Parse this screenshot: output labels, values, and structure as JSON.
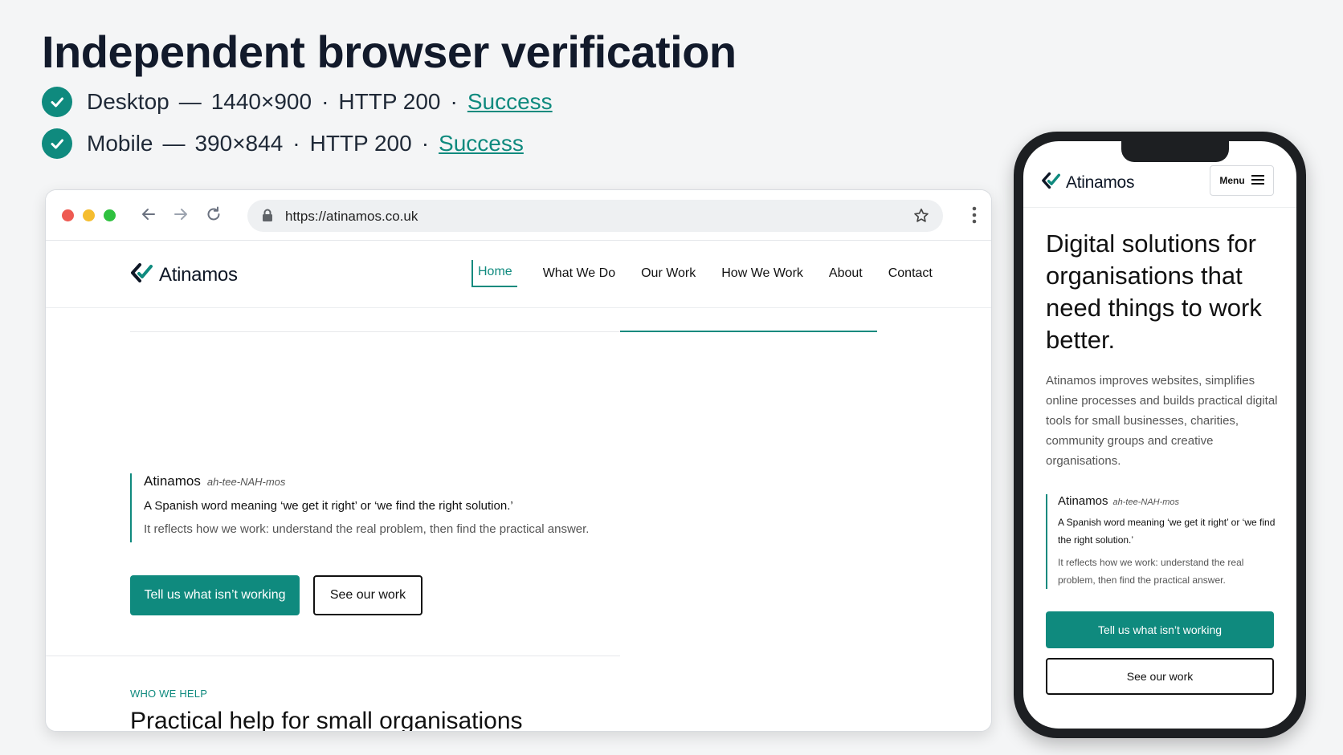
{
  "title": "Independent browser verification",
  "checks": [
    {
      "device": "Desktop",
      "dash": "—",
      "size": "1440×900",
      "dot1": "·",
      "http": "HTTP 200",
      "dot2": "·",
      "result": "Success"
    },
    {
      "device": "Mobile",
      "dash": "—",
      "size": "390×844",
      "dot1": "·",
      "http": "HTTP 200",
      "dot2": "·",
      "result": "Success"
    }
  ],
  "colors": {
    "accent": "#0f8a7e",
    "text": "#121a2b",
    "background": "#f4f5f6"
  },
  "browser": {
    "url": "https://atinamos.co.uk",
    "icons": [
      "close-light",
      "minimize-light",
      "zoom-light",
      "back-arrow-icon",
      "forward-arrow-icon",
      "reload-icon",
      "lock-icon",
      "bookmark-star-icon",
      "more-vert-icon"
    ]
  },
  "site": {
    "logo": "Atinamos",
    "nav": [
      "Home",
      "What We Do",
      "Our Work",
      "How We Work",
      "About",
      "Contact"
    ],
    "active_nav": "Home",
    "quote": {
      "name": "Atinamos",
      "pronunciation": "ah-tee-NAH-mos",
      "meaning": "A Spanish word meaning ‘we get it right’ or ‘we find the right solution.’",
      "note": "It reflects how we work: understand the real problem, then find the practical answer."
    },
    "cta_primary": "Tell us what isn’t working",
    "cta_secondary": "See our work",
    "eyebrow": "WHO WE HELP",
    "section_heading": "Practical help for small organisations"
  },
  "mobile": {
    "logo": "Atinamos",
    "menu_label": "Menu",
    "hero": "Digital solutions for organisations that need things to work better.",
    "body": "Atinamos improves websites, simplifies online processes and builds practical digital tools for small businesses, charities, community groups and creative organisations.",
    "quote": {
      "name": "Atinamos",
      "pronunciation": "ah-tee-NAH-mos",
      "meaning": "A Spanish word meaning ‘we get it right’ or ‘we find the right solution.’",
      "note": "It reflects how we work: understand the real problem, then find the practical answer."
    },
    "cta_primary": "Tell us what isn’t working",
    "cta_secondary": "See our work"
  }
}
